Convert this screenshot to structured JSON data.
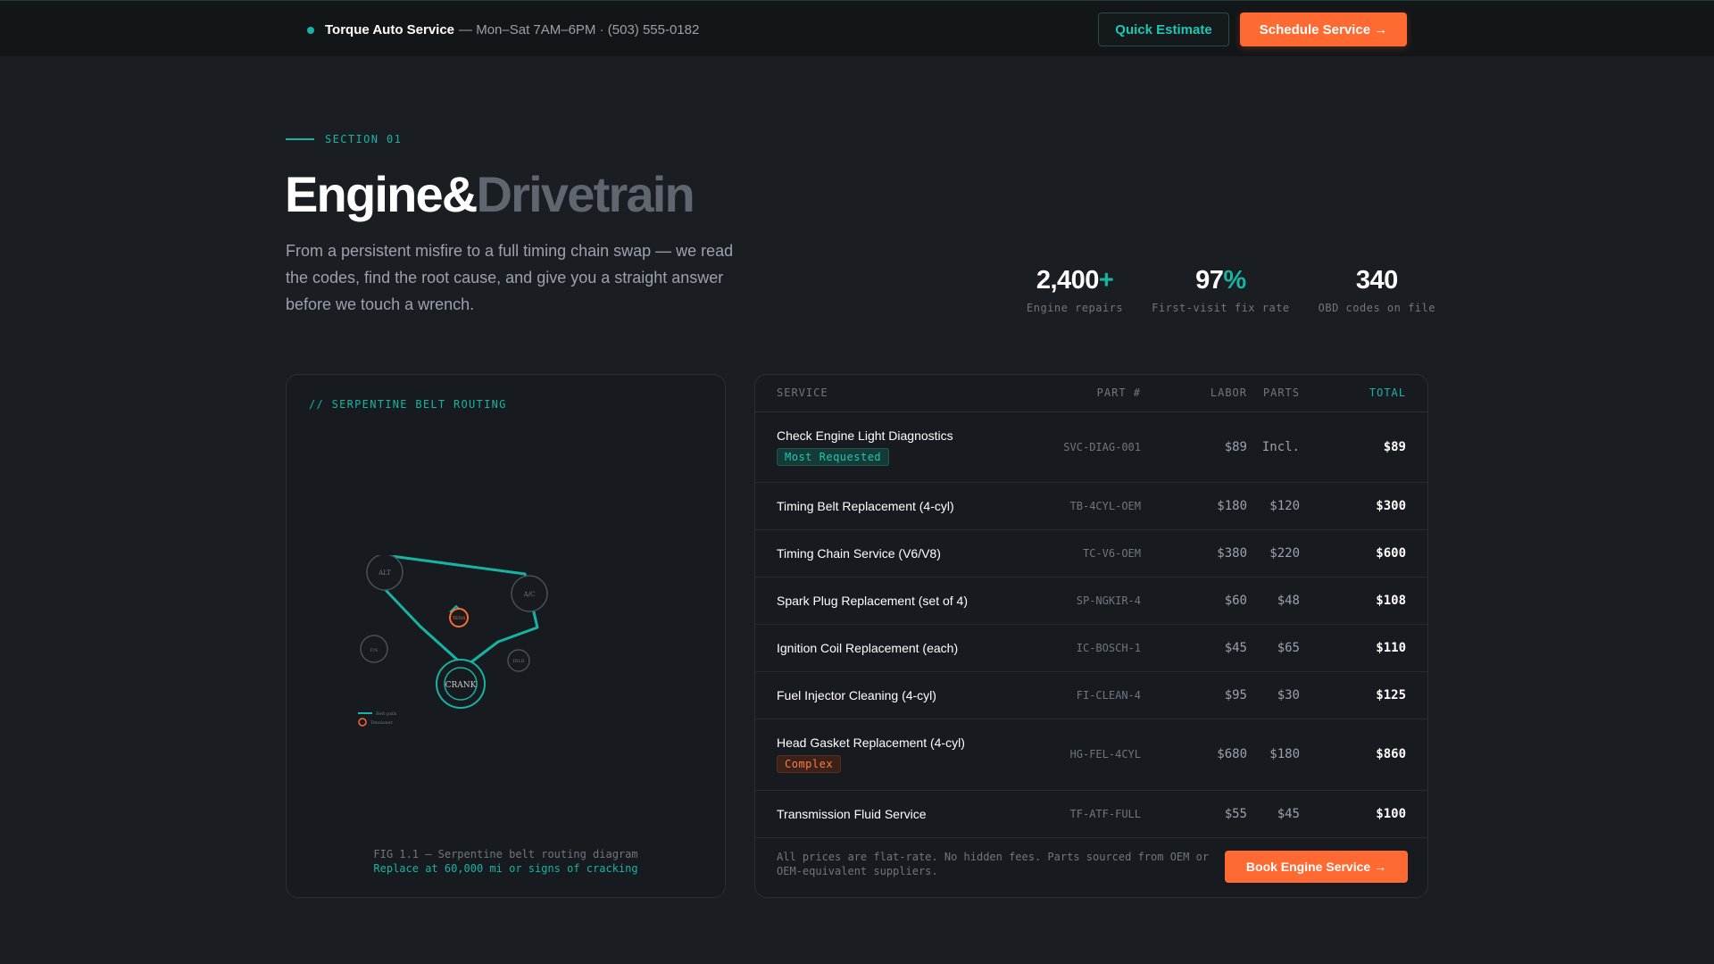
{
  "topbar": {
    "brand_name": "Torque Auto Service",
    "brand_info": "— Mon–Sat 7AM–6PM · (503) 555-0182",
    "quick_estimate": "Quick Estimate",
    "schedule_service": "Schedule Service →"
  },
  "hero": {
    "section_label": "SECTION 01",
    "title_main": "Engine&",
    "title_dim": "Drivetrain",
    "description": "From a persistent misfire to a full timing chain swap — we read the codes, find the root cause, and give you a straight answer before we touch a wrench."
  },
  "stats": [
    {
      "value": "2,400",
      "accent": "+",
      "label": "Engine repairs"
    },
    {
      "value": "97",
      "accent": "%",
      "label": "First-visit fix rate"
    },
    {
      "value": "340",
      "accent": "",
      "label": "OBD codes on file"
    }
  ],
  "diagram": {
    "title": "// SERPENTINE BELT ROUTING",
    "pulley_labels": {
      "alt": "ALT",
      "ac": "A/C",
      "tensioner": "TENS",
      "ps": "P/S",
      "idler": "IDLR",
      "crank": "CRANK"
    },
    "legend_belt": "Belt path",
    "legend_tensioner": "Tensioner",
    "caption": "FIG 1.1 — Serpentine belt routing diagram",
    "caption_note": "Replace at 60,000 mi or signs of cracking"
  },
  "table": {
    "headers": {
      "service": "SERVICE",
      "part": "PART #",
      "labor": "LABOR",
      "parts": "PARTS",
      "total": "TOTAL"
    },
    "rows": [
      {
        "service": "Check Engine Light Diagnostics",
        "badge": "Most Requested",
        "part": "SVC-DIAG-001",
        "labor": "$89",
        "parts": "Incl.",
        "total": "$89"
      },
      {
        "service": "Timing Belt Replacement (4-cyl)",
        "badge": "",
        "part": "TB-4CYL-OEM",
        "labor": "$180",
        "parts": "$120",
        "total": "$300"
      },
      {
        "service": "Timing Chain Service (V6/V8)",
        "badge": "",
        "part": "TC-V6-OEM",
        "labor": "$380",
        "parts": "$220",
        "total": "$600"
      },
      {
        "service": "Spark Plug Replacement (set of 4)",
        "badge": "",
        "part": "SP-NGKIR-4",
        "labor": "$60",
        "parts": "$48",
        "total": "$108"
      },
      {
        "service": "Ignition Coil Replacement (each)",
        "badge": "",
        "part": "IC-BOSCH-1",
        "labor": "$45",
        "parts": "$65",
        "total": "$110"
      },
      {
        "service": "Fuel Injector Cleaning (4-cyl)",
        "badge": "",
        "part": "FI-CLEAN-4",
        "labor": "$95",
        "parts": "$30",
        "total": "$125"
      },
      {
        "service": "Head Gasket Replacement (4-cyl)",
        "badge": "Complex",
        "part": "HG-FEL-4CYL",
        "labor": "$680",
        "parts": "$180",
        "total": "$860"
      },
      {
        "service": "Transmission Fluid Service",
        "badge": "",
        "part": "TF-ATF-FULL",
        "labor": "$55",
        "parts": "$45",
        "total": "$100"
      }
    ],
    "footnote": "All prices are flat-rate. No hidden fees. Parts sourced from OEM or OEM-equivalent suppliers.",
    "book_button": "Book Engine Service →"
  },
  "colors": {
    "accent": "#17b3a3",
    "cta": "#ff6a33",
    "background": "#1a1e23"
  }
}
